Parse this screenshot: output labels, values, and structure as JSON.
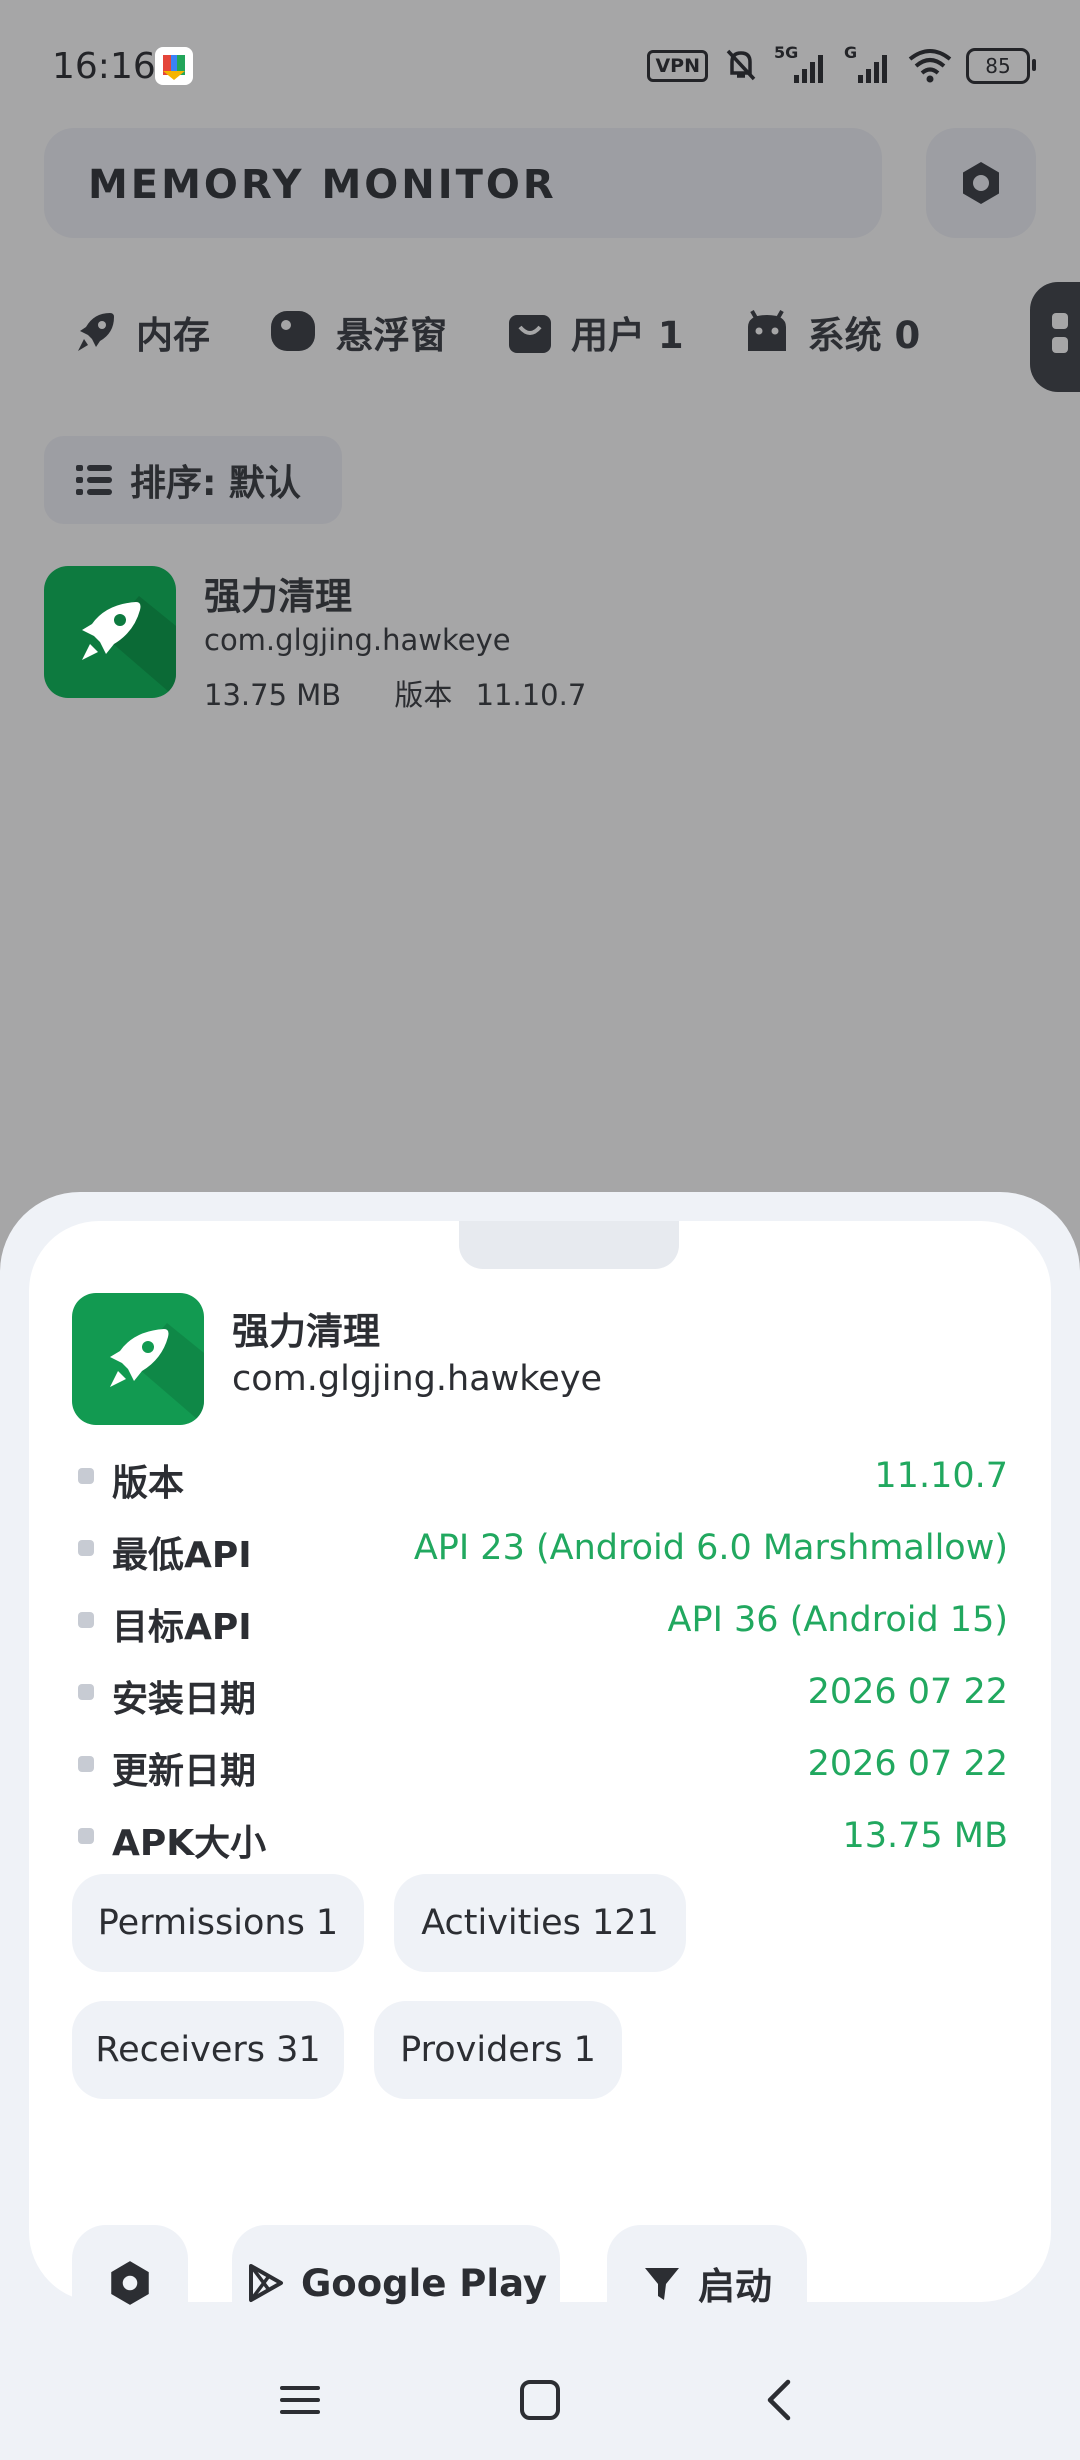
{
  "status_bar": {
    "time": "16:16",
    "vpn_label": "VPN",
    "network_labels": [
      "5G",
      "G"
    ],
    "battery": "85",
    "icons": [
      "app-notification-icon",
      "vpn-icon",
      "mute-icon",
      "signal-5g-icon",
      "signal-g-icon",
      "wifi-icon",
      "battery-icon"
    ]
  },
  "header": {
    "title": "MEMORY MONITOR",
    "settings_icon": "hexagon-settings-icon"
  },
  "tabs": [
    {
      "label": "内存",
      "icon": "rocket-icon"
    },
    {
      "label": "悬浮窗",
      "icon": "floating-window-icon"
    },
    {
      "label": "用户 1",
      "icon": "bag-icon"
    },
    {
      "label": "系统 0",
      "icon": "android-icon"
    }
  ],
  "sort": {
    "label": "排序: 默认",
    "icon": "list-icon"
  },
  "app_list": [
    {
      "name": "强力清理",
      "package": "com.glgjing.hawkeye",
      "size": "13.75 MB",
      "version_label": "版本",
      "version": "11.10.7"
    }
  ],
  "sheet": {
    "app_name": "强力清理",
    "package": "com.glgjing.hawkeye",
    "info": [
      {
        "label": "版本",
        "value": "11.10.7"
      },
      {
        "label": "最低API",
        "value": "API 23 (Android 6.0 Marshmallow)"
      },
      {
        "label": "目标API",
        "value": "API 36 (Android 15)"
      },
      {
        "label": "安装日期",
        "value": "2026 07 22"
      },
      {
        "label": "更新日期",
        "value": "2026 07 22"
      },
      {
        "label": "APK大小",
        "value": "13.75 MB"
      }
    ],
    "chips": [
      "Permissions 1",
      "Activities 121",
      "Receivers 31",
      "Providers 1"
    ],
    "actions": {
      "settings_icon": "hexagon-settings-icon",
      "google_play": "Google Play",
      "launch": "启动"
    },
    "accent_color": "#21a85f"
  },
  "nav": {
    "icons": [
      "menu-icon",
      "home-icon",
      "back-icon"
    ]
  }
}
